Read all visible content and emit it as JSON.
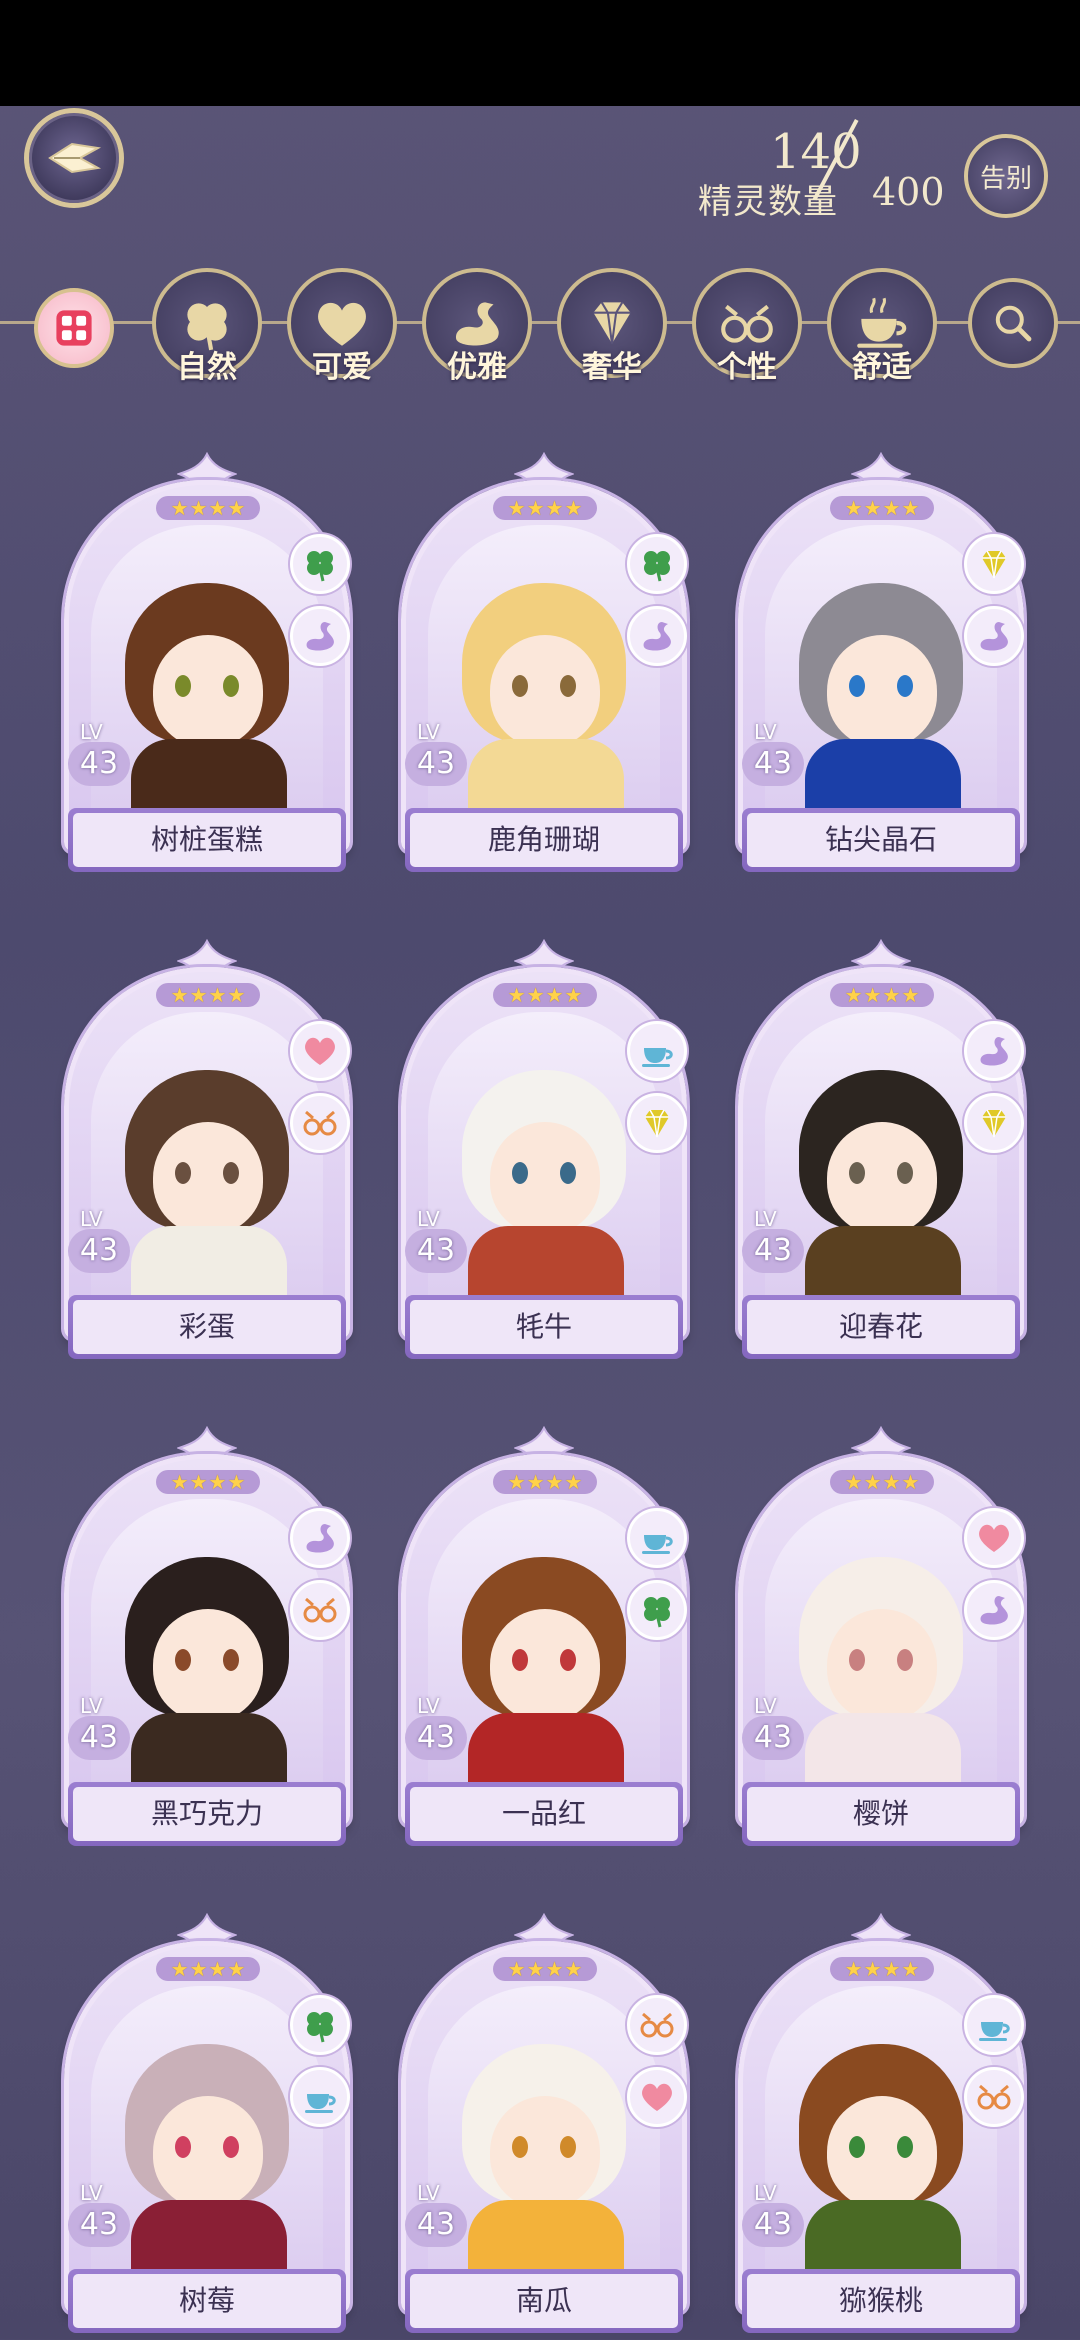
{
  "header": {
    "count_label": "精灵数量",
    "count_current": "140",
    "count_max": "400",
    "farewell_label": "告别"
  },
  "categories": [
    {
      "label": "自然",
      "icon": "clover-icon"
    },
    {
      "label": "可爱",
      "icon": "heart-icon"
    },
    {
      "label": "优雅",
      "icon": "swan-icon"
    },
    {
      "label": "奢华",
      "icon": "diamond-icon"
    },
    {
      "label": "个性",
      "icon": "glasses-icon"
    },
    {
      "label": "舒适",
      "icon": "teacup-icon"
    }
  ],
  "colors": {
    "accent_gold": "#d9c79a",
    "card_purple": "#8467bf",
    "attr_clover": "#3f9e4c",
    "attr_swan": "#b493db",
    "attr_diamond": "#d9c12a",
    "attr_heart": "#f08aa0",
    "attr_glasses": "#e68a44",
    "attr_teacup": "#5fb5d6"
  },
  "cards": [
    {
      "name": "树桩蛋糕",
      "level": "43",
      "lv_label": "LV",
      "attrs": [
        "clover",
        "swan"
      ],
      "hair": "#6b3a1f",
      "body": "#4a2a1a",
      "eye": "#7a8a2a"
    },
    {
      "name": "鹿角珊瑚",
      "level": "43",
      "lv_label": "LV",
      "attrs": [
        "clover",
        "swan"
      ],
      "hair": "#f2cf7e",
      "body": "#f3d995",
      "eye": "#8a6a3a"
    },
    {
      "name": "钻尖晶石",
      "level": "43",
      "lv_label": "LV",
      "attrs": [
        "diamond",
        "swan"
      ],
      "hair": "#8d8a93",
      "body": "#1b3fa8",
      "eye": "#2a78c9"
    },
    {
      "name": "彩蛋",
      "level": "43",
      "lv_label": "LV",
      "attrs": [
        "heart",
        "glasses"
      ],
      "hair": "#5a3d2c",
      "body": "#f1ede4",
      "eye": "#6a5040"
    },
    {
      "name": "牦牛",
      "level": "43",
      "lv_label": "LV",
      "attrs": [
        "teacup",
        "diamond"
      ],
      "hair": "#f4f2ee",
      "body": "#b7452f",
      "eye": "#3a6a8a"
    },
    {
      "name": "迎春花",
      "level": "43",
      "lv_label": "LV",
      "attrs": [
        "swan",
        "diamond"
      ],
      "hair": "#2c2520",
      "body": "#5a4020",
      "eye": "#6a6050"
    },
    {
      "name": "黑巧克力",
      "level": "43",
      "lv_label": "LV",
      "attrs": [
        "swan",
        "glasses"
      ],
      "hair": "#2a1f1d",
      "body": "#3b2a20",
      "eye": "#8a4a2a"
    },
    {
      "name": "一品红",
      "level": "43",
      "lv_label": "LV",
      "attrs": [
        "teacup",
        "clover"
      ],
      "hair": "#8a4a22",
      "body": "#b32626",
      "eye": "#c0383a"
    },
    {
      "name": "樱饼",
      "level": "43",
      "lv_label": "LV",
      "attrs": [
        "heart",
        "swan"
      ],
      "hair": "#f6eee8",
      "body": "#f3e6e8",
      "eye": "#c88080"
    },
    {
      "name": "树莓",
      "level": "43",
      "lv_label": "LV",
      "attrs": [
        "clover",
        "teacup"
      ],
      "hair": "#c9b0b8",
      "body": "#8a1f35",
      "eye": "#d04060"
    },
    {
      "name": "南瓜",
      "level": "43",
      "lv_label": "LV",
      "attrs": [
        "glasses",
        "heart"
      ],
      "hair": "#f6f1ea",
      "body": "#f3b23a",
      "eye": "#d08a2a"
    },
    {
      "name": "猕猴桃",
      "level": "43",
      "lv_label": "LV",
      "attrs": [
        "teacup",
        "glasses"
      ],
      "hair": "#8a4a20",
      "body": "#4a6a24",
      "eye": "#3a8a3a"
    }
  ]
}
